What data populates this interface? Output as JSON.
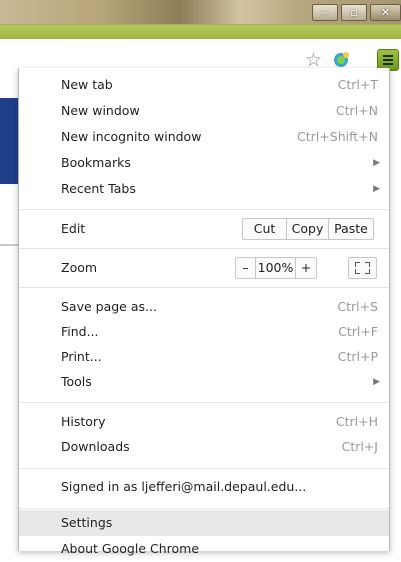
{
  "window_controls": {
    "minimize": "–",
    "maximize": "▫",
    "close": "✕"
  },
  "toolbar": {
    "star_icon": "star-icon",
    "extension_icon": "extension-icon",
    "menu_icon": "menu-icon"
  },
  "menu": {
    "new_tab": {
      "label": "New tab",
      "shortcut": "Ctrl+T"
    },
    "new_window": {
      "label": "New window",
      "shortcut": "Ctrl+N"
    },
    "new_incognito": {
      "label": "New incognito window",
      "shortcut": "Ctrl+Shift+N"
    },
    "bookmarks": {
      "label": "Bookmarks"
    },
    "recent_tabs": {
      "label": "Recent Tabs"
    },
    "edit": {
      "label": "Edit",
      "cut": "Cut",
      "copy": "Copy",
      "paste": "Paste"
    },
    "zoom": {
      "label": "Zoom",
      "minus": "–",
      "level": "100%",
      "plus": "+"
    },
    "save_page": {
      "label": "Save page as...",
      "shortcut": "Ctrl+S"
    },
    "find": {
      "label": "Find...",
      "shortcut": "Ctrl+F"
    },
    "print": {
      "label": "Print...",
      "shortcut": "Ctrl+P"
    },
    "tools": {
      "label": "Tools"
    },
    "history": {
      "label": "History",
      "shortcut": "Ctrl+H"
    },
    "downloads": {
      "label": "Downloads",
      "shortcut": "Ctrl+J"
    },
    "signed_in": {
      "label": "Signed in as ljefferi@mail.depaul.edu..."
    },
    "settings": {
      "label": "Settings"
    },
    "about": {
      "label": "About Google Chrome"
    }
  }
}
